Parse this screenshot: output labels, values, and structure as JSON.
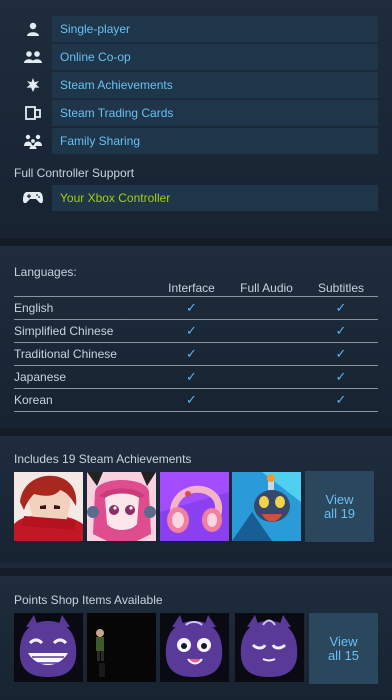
{
  "features": [
    {
      "label": "Single-player",
      "icon": "user-icon"
    },
    {
      "label": "Online Co-op",
      "icon": "users-icon"
    },
    {
      "label": "Steam Achievements",
      "icon": "achievement-star-icon"
    },
    {
      "label": "Steam Trading Cards",
      "icon": "trading-cards-icon"
    },
    {
      "label": "Family Sharing",
      "icon": "family-icon"
    }
  ],
  "controller": {
    "heading": "Full Controller Support",
    "label": "Your Xbox Controller",
    "icon": "gamepad-icon"
  },
  "languages": {
    "heading": "Languages:",
    "columns": [
      "Interface",
      "Full Audio",
      "Subtitles"
    ],
    "check_glyph": "✓",
    "rows": [
      {
        "name": "English",
        "interface": true,
        "audio": false,
        "subtitles": true
      },
      {
        "name": "Simplified Chinese",
        "interface": true,
        "audio": false,
        "subtitles": true
      },
      {
        "name": "Traditional Chinese",
        "interface": true,
        "audio": false,
        "subtitles": true
      },
      {
        "name": "Japanese",
        "interface": true,
        "audio": false,
        "subtitles": true
      },
      {
        "name": "Korean",
        "interface": true,
        "audio": false,
        "subtitles": true
      }
    ]
  },
  "achievements": {
    "heading": "Includes 19 Steam Achievements",
    "view_all_line1": "View",
    "view_all_line2": "all 19"
  },
  "points_shop": {
    "heading": "Points Shop Items Available",
    "view_all_line1": "View",
    "view_all_line2": "all 15"
  },
  "colors": {
    "link_blue": "#67c1f5",
    "controller_green": "#a4d007",
    "row_bg": "#1f3549",
    "page_bg": "#1b2838"
  }
}
